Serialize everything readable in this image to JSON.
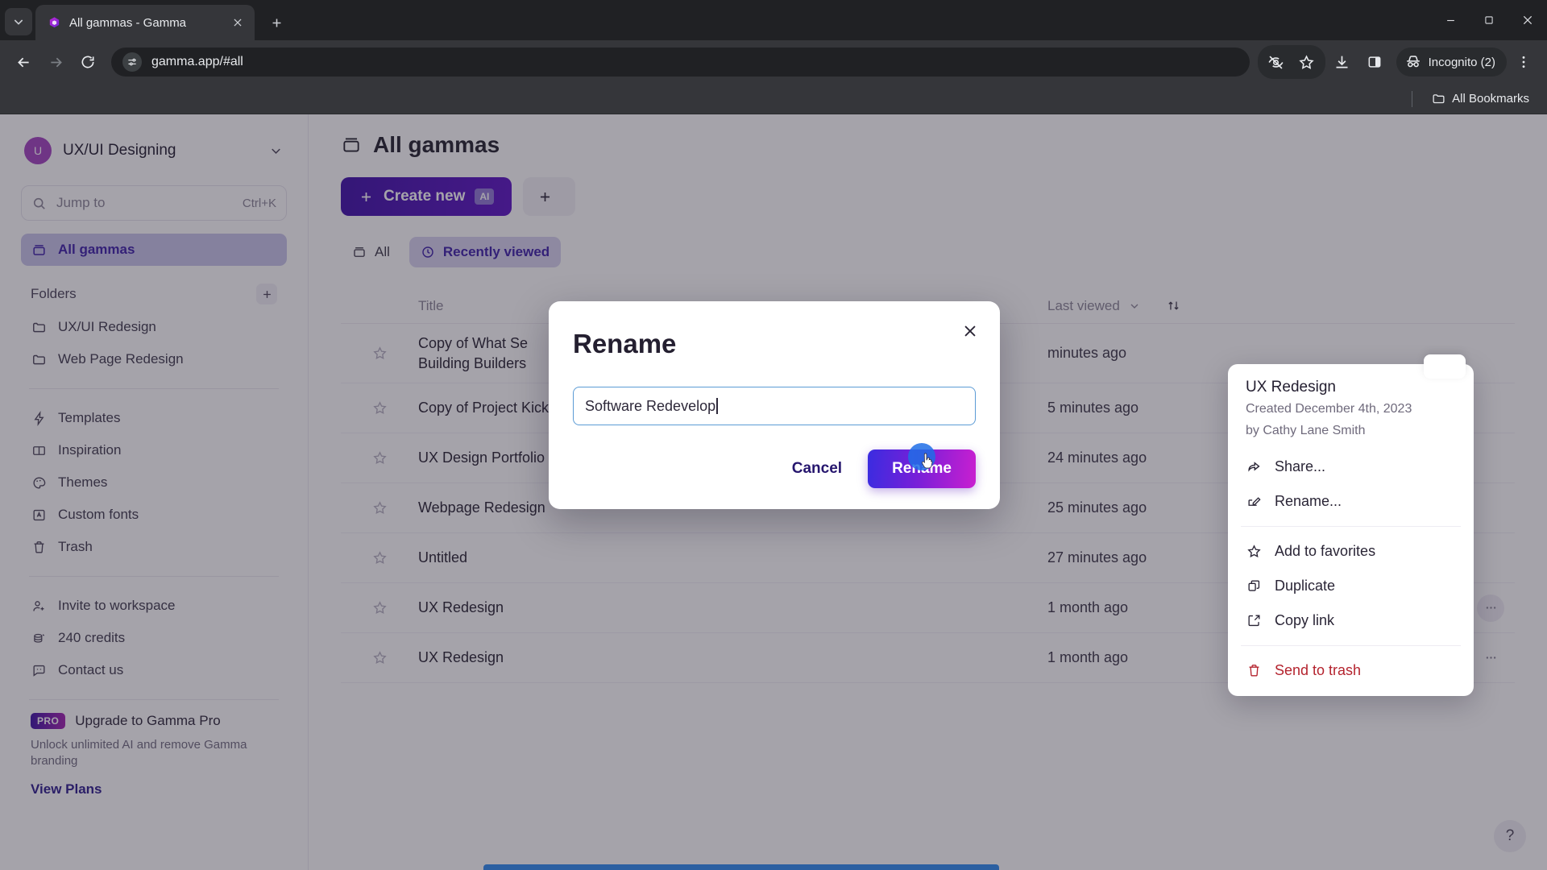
{
  "browser": {
    "tab": {
      "title": "All gammas - Gamma",
      "favicon": "gamma-logo-icon"
    },
    "new_tab_label": "+",
    "url": "gamma.app/#all",
    "incognito_label": "Incognito (2)",
    "bookmarks_label": "All Bookmarks",
    "window_controls": {
      "minimize": "minimize-icon",
      "maximize": "maximize-icon",
      "close": "close-icon"
    }
  },
  "sidebar": {
    "workspace": {
      "initial": "U",
      "name": "UX/UI Designing"
    },
    "search": {
      "placeholder": "Jump to",
      "shortcut": "Ctrl+K"
    },
    "primary": [
      {
        "label": "All gammas",
        "icon": "archive-icon",
        "active": true
      }
    ],
    "folders_header": "Folders",
    "folders": [
      {
        "label": "UX/UI Redesign",
        "icon": "folder-icon"
      },
      {
        "label": "Web Page Redesign",
        "icon": "folder-icon"
      }
    ],
    "tools": [
      {
        "label": "Templates",
        "icon": "lightning-icon"
      },
      {
        "label": "Inspiration",
        "icon": "book-icon"
      },
      {
        "label": "Themes",
        "icon": "palette-icon"
      },
      {
        "label": "Custom fonts",
        "icon": "font-icon"
      },
      {
        "label": "Trash",
        "icon": "trash-icon"
      }
    ],
    "account": [
      {
        "label": "Invite to workspace",
        "icon": "user-plus-icon"
      },
      {
        "label": "240 credits",
        "icon": "coins-icon"
      },
      {
        "label": "Contact us",
        "icon": "chat-icon"
      }
    ],
    "pro": {
      "badge": "PRO",
      "title": "Upgrade to Gamma Pro",
      "subtitle": "Unlock unlimited AI and remove Gamma branding",
      "link": "View Plans"
    }
  },
  "main": {
    "title": "All gammas",
    "create_button": {
      "label": "Create new",
      "badge": "AI"
    },
    "secondary_button": {
      "label": ""
    },
    "filters": [
      {
        "label": "All",
        "icon": "archive-icon",
        "active": false
      },
      {
        "label": "Recently viewed",
        "icon": "clock-icon",
        "active": true
      }
    ],
    "columns": {
      "title": "Title",
      "last_viewed": "Last viewed",
      "sort": "sort-icon"
    },
    "rows": [
      {
        "title": "Copy of What Se\nBuilding Builders",
        "last_viewed": "minutes ago",
        "owner": ""
      },
      {
        "title": "Copy of Project Kickoff Template",
        "last_viewed": "5 minutes ago",
        "owner": ""
      },
      {
        "title": "UX Design Portfolio for [Name]",
        "last_viewed": "24 minutes ago",
        "owner": ""
      },
      {
        "title": "Webpage Redesign",
        "last_viewed": "25 minutes ago",
        "owner": ""
      },
      {
        "title": "Untitled",
        "last_viewed": "27 minutes ago",
        "owner": ""
      },
      {
        "title": "UX Redesign",
        "last_viewed": "1 month ago",
        "owner": "Cathy Lane Smith"
      },
      {
        "title": "UX Redesign",
        "last_viewed": "1 month ago",
        "owner": "Cathy Lane Smith"
      }
    ],
    "help_label": "?"
  },
  "dialog": {
    "title": "Rename",
    "input_value": "Software Redevelop",
    "cancel_label": "Cancel",
    "confirm_label": "Rename",
    "close_icon": "close-icon"
  },
  "context_menu": {
    "title": "UX Redesign",
    "meta_line1": "Created December 4th, 2023",
    "meta_line2": "by Cathy Lane Smith",
    "items": [
      {
        "label": "Share...",
        "icon": "share-icon",
        "danger": false
      },
      {
        "label": "Rename...",
        "icon": "rename-icon",
        "danger": false
      },
      {
        "label": "Add to favorites",
        "icon": "star-icon",
        "danger": false
      },
      {
        "label": "Duplicate",
        "icon": "duplicate-icon",
        "danger": false
      },
      {
        "label": "Copy link",
        "icon": "copy-link-icon",
        "danger": false
      },
      {
        "label": "Send to trash",
        "icon": "trash-icon",
        "danger": true
      }
    ]
  },
  "colors": {
    "brand_purple": "#3c1ea8",
    "gradient_start": "#3a2ce0",
    "gradient_end": "#c91fd0",
    "danger_red": "#b4232e",
    "chrome_dark": "#202124"
  }
}
